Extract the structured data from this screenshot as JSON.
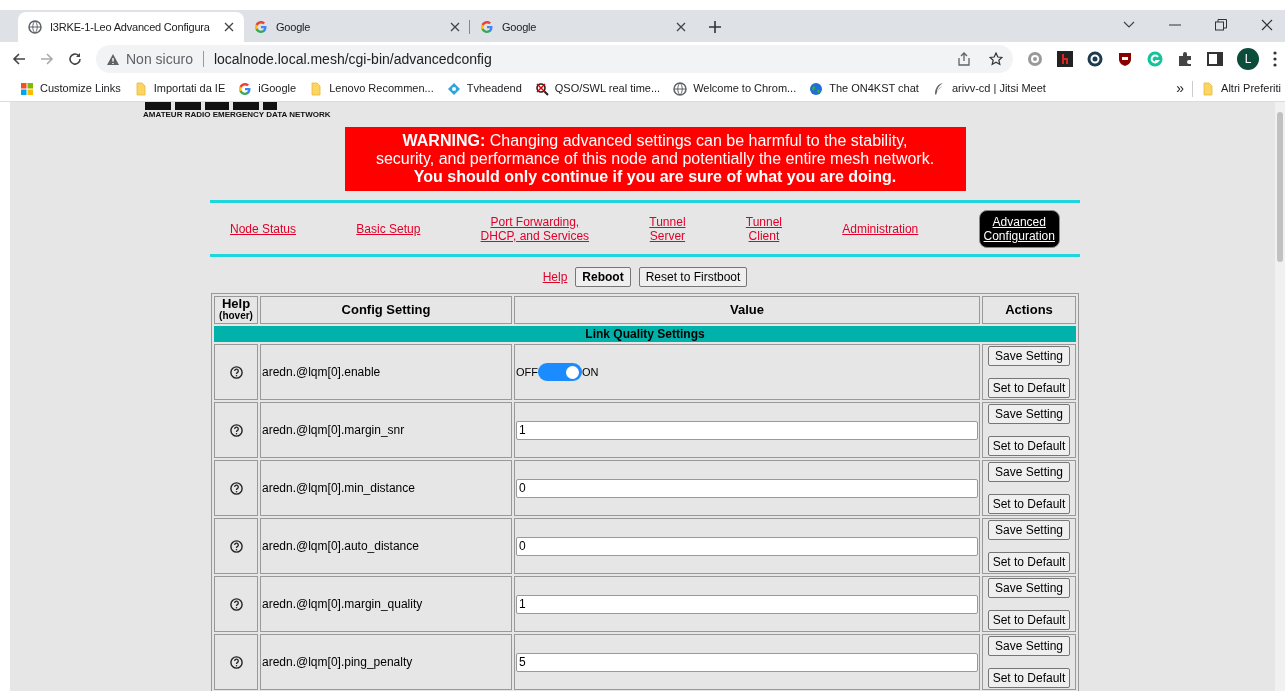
{
  "browser": {
    "tabs": [
      {
        "title": "I3RKE-1-Leo Advanced Configura",
        "selected": true
      },
      {
        "title": "Google",
        "selected": false
      },
      {
        "title": "Google",
        "selected": false
      }
    ],
    "security": "Non sicuro",
    "url": "localnode.local.mesh/cgi-bin/advancedconfig",
    "profile_initial": "L",
    "bookmarks": [
      "Customize Links",
      "Importati da IE",
      "iGoogle",
      "Lenovo Recommen...",
      "Tvheadend",
      "QSO/SWL real time...",
      "Welcome to Chrom...",
      "The ON4KST chat",
      "arivv-cd | Jitsi Meet"
    ],
    "more_bookmarks": "»",
    "other_bookmarks": "Altri Preferiti"
  },
  "page": {
    "logo_subtitle": "AMATEUR RADIO EMERGENCY DATA NETWORK",
    "warning": [
      "**WARNING:** Changing advanced settings can be harmful to the stability,",
      "security, and performance of this node and potentially the entire mesh network.",
      "**You should only continue if you are sure of what you are doing.**"
    ],
    "nav": [
      {
        "label": "Node Status",
        "selected": false
      },
      {
        "label": "Basic Setup",
        "selected": false
      },
      {
        "label": "Port Forwarding,\nDHCP, and Services",
        "selected": false
      },
      {
        "label": "Tunnel\nServer",
        "selected": false
      },
      {
        "label": "Tunnel\nClient",
        "selected": false
      },
      {
        "label": "Administration",
        "selected": false
      },
      {
        "label": "Advanced\nConfiguration",
        "selected": true
      }
    ],
    "help_link": "Help",
    "buttons": [
      "Reboot",
      "Reset to Firstboot"
    ],
    "table": {
      "columns": [
        {
          "label": "Help",
          "sub": "(hover)"
        },
        {
          "label": "Config Setting"
        },
        {
          "label": "Value"
        },
        {
          "label": "Actions"
        }
      ],
      "section": "Link Quality Settings",
      "rows": [
        {
          "setting": "aredn.@lqm[0].enable",
          "kind": "toggle",
          "on": true,
          "off_label": "OFF",
          "on_label": "ON",
          "save": "Save Setting",
          "default": "Set to Default"
        },
        {
          "setting": "aredn.@lqm[0].margin_snr",
          "kind": "text",
          "value": "1",
          "save": "Save Setting",
          "default": "Set to Default"
        },
        {
          "setting": "aredn.@lqm[0].min_distance",
          "kind": "text",
          "value": "0",
          "save": "Save Setting",
          "default": "Set to Default"
        },
        {
          "setting": "aredn.@lqm[0].auto_distance",
          "kind": "text",
          "value": "0",
          "save": "Save Setting",
          "default": "Set to Default"
        },
        {
          "setting": "aredn.@lqm[0].margin_quality",
          "kind": "text",
          "value": "1",
          "save": "Save Setting",
          "default": "Set to Default"
        },
        {
          "setting": "aredn.@lqm[0].ping_penalty",
          "kind": "text",
          "value": "5",
          "save": "Save Setting",
          "default": "Set to Default"
        }
      ]
    }
  }
}
